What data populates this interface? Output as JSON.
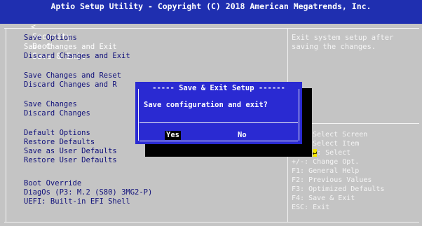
{
  "header": {
    "title": "Aptio Setup Utility - Copyright (C) 2018 American Megatrends, Inc.",
    "tab_arrow": "<",
    "tabs": [
      "Security",
      "Boot",
      "Save & Exit"
    ],
    "active_tab": "Save & Exit"
  },
  "menu": {
    "save_options_heading": "Save Options",
    "save_changes_and_exit": "Save Changes and Exit",
    "discard_changes_and_exit": "Discard Changes and Exit",
    "save_changes_and_reset": "Save Changes and Reset",
    "discard_changes_and_reset": "Discard Changes and R",
    "save_changes": "Save Changes",
    "discard_changes": "Discard Changes",
    "default_options_heading": "Default Options",
    "restore_defaults": "Restore Defaults",
    "save_as_user_defaults": "Save as User Defaults",
    "restore_user_defaults": "Restore User Defaults",
    "boot_override_heading": "Boot Override",
    "boot_option_1": "DiagOs (P3: M.2 (S80) 3MG2-P)",
    "boot_option_2": "UEFI: Built-in EFI Shell"
  },
  "help": {
    "line1": "Exit system setup after",
    "line2": "saving the changes."
  },
  "legend": {
    "select_screen": "Select Screen",
    "select_item": "Select Item",
    "enter_select_key": "↵",
    "enter_select": ": Select",
    "change_opt": "+/-: Change Opt.",
    "general_help": "F1: General Help",
    "previous_values": "F2: Previous Values",
    "optimized_defaults": "F3: Optimized Defaults",
    "save_exit": "F4: Save & Exit",
    "esc_exit": "ESC: Exit"
  },
  "dialog": {
    "title": "Save & Exit Setup",
    "message": "Save configuration and exit?",
    "yes_label": "Yes",
    "no_label": "No"
  },
  "colors": {
    "header_blue": "#1f2fb0",
    "background_gray": "#c4c4c4",
    "dialog_blue": "#2a2ad2",
    "menu_text_navy": "#10107a",
    "selection_yellow": "#f1e500"
  }
}
